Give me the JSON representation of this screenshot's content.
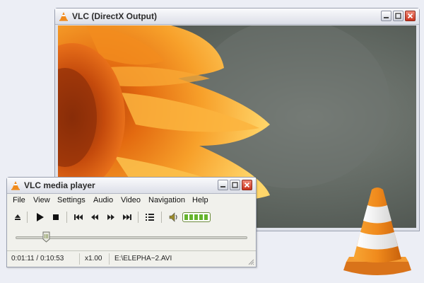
{
  "video_window": {
    "title": "VLC (DirectX Output)"
  },
  "player_window": {
    "title": "VLC media player",
    "menu": [
      {
        "label": "File"
      },
      {
        "label": "View"
      },
      {
        "label": "Settings"
      },
      {
        "label": "Audio"
      },
      {
        "label": "Video"
      },
      {
        "label": "Navigation"
      },
      {
        "label": "Help"
      }
    ],
    "controls": {
      "icons": [
        "eject-icon",
        "play-icon",
        "stop-icon",
        "previous-icon",
        "rewind-icon",
        "fast-forward-icon",
        "next-icon",
        "playlist-icon",
        "volume-icon"
      ],
      "volume_level": 1.0
    },
    "seek": {
      "position_fraction": 0.13
    },
    "status": {
      "time": "0:01:11 / 0:10:53",
      "speed": "x1.00",
      "file": "E:\\ELEPHA~2.AVI"
    }
  },
  "colors": {
    "accent": "#f08a1c",
    "volume": "#65b42d",
    "close_button": "#c9321c"
  }
}
